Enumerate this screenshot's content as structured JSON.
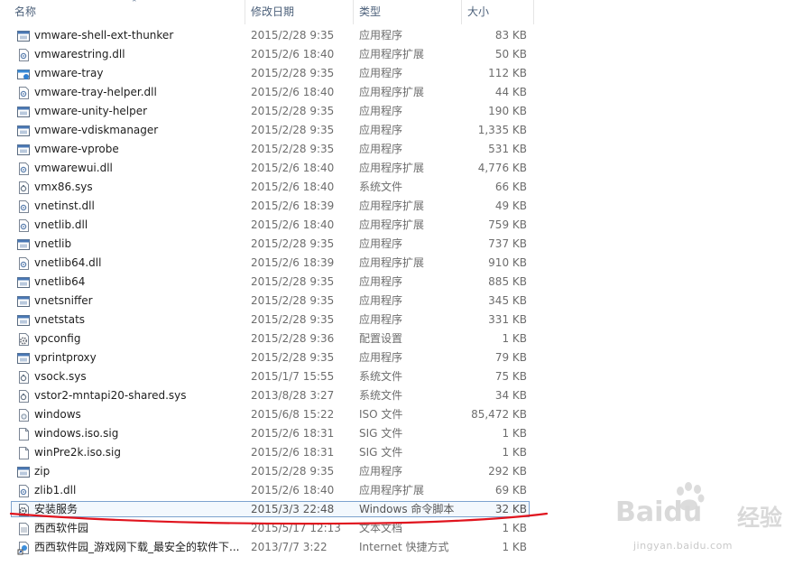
{
  "header": {
    "col_name": "名称",
    "col_date": "修改日期",
    "col_type": "类型",
    "col_size": "大小"
  },
  "files": [
    {
      "name": "vmware-shell-ext-thunker",
      "date": "2015/2/28 9:35",
      "type": "应用程序",
      "size": "83 KB",
      "icon": "app-icon"
    },
    {
      "name": "vmwarestring.dll",
      "date": "2015/2/6 18:40",
      "type": "应用程序扩展",
      "size": "50 KB",
      "icon": "dll-icon"
    },
    {
      "name": "vmware-tray",
      "date": "2015/2/28 9:35",
      "type": "应用程序",
      "size": "112 KB",
      "icon": "tray-app-icon"
    },
    {
      "name": "vmware-tray-helper.dll",
      "date": "2015/2/6 18:40",
      "type": "应用程序扩展",
      "size": "44 KB",
      "icon": "dll-icon"
    },
    {
      "name": "vmware-unity-helper",
      "date": "2015/2/28 9:35",
      "type": "应用程序",
      "size": "190 KB",
      "icon": "app-icon"
    },
    {
      "name": "vmware-vdiskmanager",
      "date": "2015/2/28 9:35",
      "type": "应用程序",
      "size": "1,335 KB",
      "icon": "app-icon"
    },
    {
      "name": "vmware-vprobe",
      "date": "2015/2/28 9:35",
      "type": "应用程序",
      "size": "531 KB",
      "icon": "app-icon"
    },
    {
      "name": "vmwarewui.dll",
      "date": "2015/2/6 18:40",
      "type": "应用程序扩展",
      "size": "4,776 KB",
      "icon": "dll-icon"
    },
    {
      "name": "vmx86.sys",
      "date": "2015/2/6 18:40",
      "type": "系统文件",
      "size": "66 KB",
      "icon": "sys-file-icon"
    },
    {
      "name": "vnetinst.dll",
      "date": "2015/2/6 18:39",
      "type": "应用程序扩展",
      "size": "49 KB",
      "icon": "dll-icon"
    },
    {
      "name": "vnetlib.dll",
      "date": "2015/2/6 18:40",
      "type": "应用程序扩展",
      "size": "759 KB",
      "icon": "dll-icon"
    },
    {
      "name": "vnetlib",
      "date": "2015/2/28 9:35",
      "type": "应用程序",
      "size": "737 KB",
      "icon": "app-icon"
    },
    {
      "name": "vnetlib64.dll",
      "date": "2015/2/6 18:39",
      "type": "应用程序扩展",
      "size": "910 KB",
      "icon": "dll-icon"
    },
    {
      "name": "vnetlib64",
      "date": "2015/2/28 9:35",
      "type": "应用程序",
      "size": "885 KB",
      "icon": "app-icon"
    },
    {
      "name": "vnetsniffer",
      "date": "2015/2/28 9:35",
      "type": "应用程序",
      "size": "345 KB",
      "icon": "app-icon"
    },
    {
      "name": "vnetstats",
      "date": "2015/2/28 9:35",
      "type": "应用程序",
      "size": "331 KB",
      "icon": "app-icon"
    },
    {
      "name": "vpconfig",
      "date": "2015/2/28 9:36",
      "type": "配置设置",
      "size": "1 KB",
      "icon": "config-gear-icon"
    },
    {
      "name": "vprintproxy",
      "date": "2015/2/28 9:35",
      "type": "应用程序",
      "size": "79 KB",
      "icon": "app-icon"
    },
    {
      "name": "vsock.sys",
      "date": "2015/1/7 15:55",
      "type": "系统文件",
      "size": "75 KB",
      "icon": "sys-file-icon"
    },
    {
      "name": "vstor2-mntapi20-shared.sys",
      "date": "2013/8/28 3:27",
      "type": "系统文件",
      "size": "34 KB",
      "icon": "sys-file-icon"
    },
    {
      "name": "windows",
      "date": "2015/6/8 15:22",
      "type": "ISO 文件",
      "size": "85,472 KB",
      "icon": "iso-file-icon"
    },
    {
      "name": "windows.iso.sig",
      "date": "2015/2/6 18:31",
      "type": "SIG 文件",
      "size": "1 KB",
      "icon": "blank-file-icon"
    },
    {
      "name": "winPre2k.iso.sig",
      "date": "2015/2/6 18:31",
      "type": "SIG 文件",
      "size": "1 KB",
      "icon": "blank-file-icon"
    },
    {
      "name": "zip",
      "date": "2015/2/28 9:35",
      "type": "应用程序",
      "size": "292 KB",
      "icon": "app-icon"
    },
    {
      "name": "zlib1.dll",
      "date": "2015/2/6 18:40",
      "type": "应用程序扩展",
      "size": "69 KB",
      "icon": "dll-icon"
    },
    {
      "name": "安装服务",
      "date": "2015/3/3 22:48",
      "type": "Windows 命令脚本",
      "size": "32 KB",
      "icon": "script-gear-icon",
      "selected": true
    },
    {
      "name": "西西软件园",
      "date": "2015/5/17 12:13",
      "type": "文本文档",
      "size": "1 KB",
      "icon": "text-file-icon"
    },
    {
      "name": "西西软件园_游戏网下载_最安全的软件下...",
      "date": "2013/7/7 3:22",
      "type": "Internet 快捷方式",
      "size": "1 KB",
      "icon": "internet-shortcut-icon"
    }
  ],
  "watermark": {
    "brand": "Baidu",
    "suffix": "经验",
    "url": "jingyan.baidu.com"
  },
  "colors": {
    "header_text": "#4c607a",
    "selection_border": "#7da2ce",
    "annotation_red": "#e0141e",
    "watermark_gray": "#d9d9d9"
  }
}
